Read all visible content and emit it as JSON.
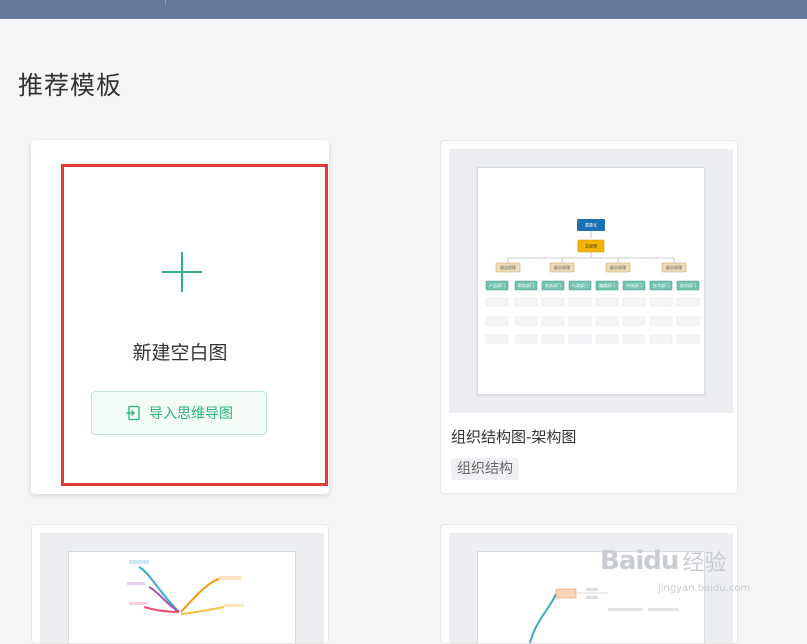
{
  "section": {
    "title": "推荐模板"
  },
  "new_card": {
    "label": "新建空白图",
    "import_label": "导入思维导图"
  },
  "templates": [
    {
      "title": "组织结构图-架构图",
      "tag": "组织结构",
      "thumb": {
        "root": "董事长",
        "level1": "总经理",
        "level2": [
          "副总经理",
          "副总经理",
          "副总经理",
          "副总经理"
        ],
        "departments": [
          "产品部门",
          "财务部门",
          "财务部门",
          "行政部门",
          "编辑部门",
          "市场部门",
          "技术部门",
          "综合部门"
        ]
      }
    }
  ],
  "watermark": {
    "brand_en": "Baidu",
    "brand_cn": "经验",
    "url": "jingyan.baidu.com"
  },
  "colors": {
    "topbar": "#64799b",
    "accent": "#2bb27e",
    "highlight": "#e13b35"
  }
}
